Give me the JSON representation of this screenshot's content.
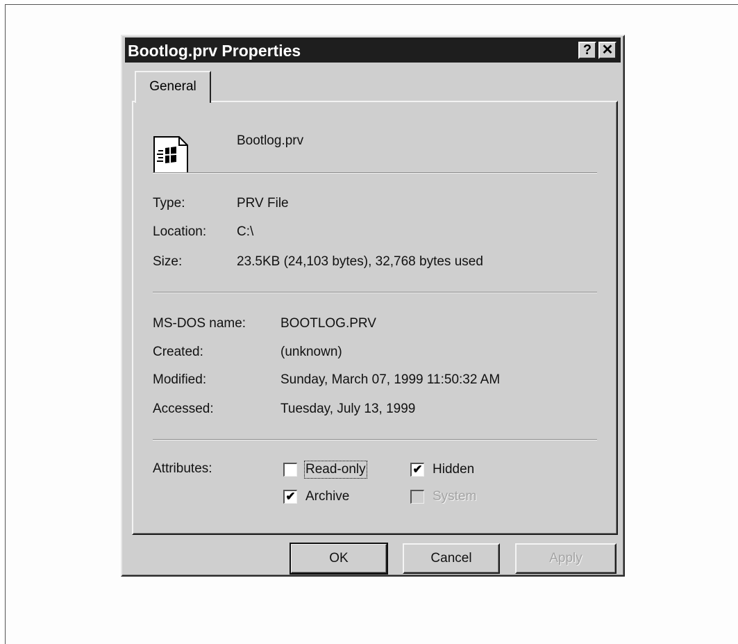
{
  "window": {
    "title": "Bootlog.prv Properties"
  },
  "titlebar": {
    "help_glyph": "?",
    "close_glyph": "✕"
  },
  "tabs": [
    {
      "label": "General",
      "active": true
    }
  ],
  "file": {
    "name": "Bootlog.prv",
    "icon": "windows-document-icon"
  },
  "info": {
    "type_label": "Type:",
    "type_value": "PRV File",
    "location_label": "Location:",
    "location_value": "C:\\",
    "size_label": "Size:",
    "size_value": "23.5KB (24,103 bytes), 32,768 bytes used"
  },
  "dates": {
    "msdos_label": "MS-DOS name:",
    "msdos_value": "BOOTLOG.PRV",
    "created_label": "Created:",
    "created_value": "(unknown)",
    "modified_label": "Modified:",
    "modified_value": "Sunday, March 07, 1999 11:50:32 AM",
    "accessed_label": "Accessed:",
    "accessed_value": "Tuesday, July 13, 1999"
  },
  "attributes": {
    "label": "Attributes:",
    "read_only": {
      "label": "Read-only",
      "checked": false,
      "checked_glyph": ""
    },
    "hidden": {
      "label": "Hidden",
      "checked": true,
      "checked_glyph": "✔"
    },
    "archive": {
      "label": "Archive",
      "checked": true,
      "checked_glyph": "✔"
    },
    "system": {
      "label": "System",
      "checked": false,
      "disabled": true,
      "checked_glyph": ""
    }
  },
  "buttons": {
    "ok": "OK",
    "cancel": "Cancel",
    "apply": "Apply"
  }
}
